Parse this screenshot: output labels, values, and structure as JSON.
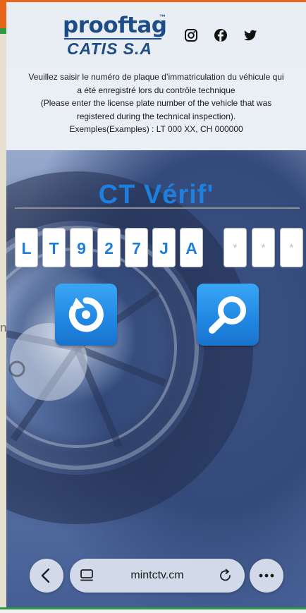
{
  "header": {
    "brand_name": "prooftag",
    "brand_tm": "™",
    "brand_sub": "CATIS S.A",
    "social": [
      "instagram-icon",
      "facebook-icon",
      "twitter-icon"
    ]
  },
  "instructions": {
    "lines": [
      "Veuillez saisir le numéro de plaque d’immatriculation du véhicule qui",
      "a été enregistré lors du contrôle technique",
      "(Please enter the license plate number of the vehicle that was",
      "registered during the technical inspection).",
      "Exemples(Examples) : LT 000 XX, CH 000000"
    ]
  },
  "hero": {
    "title": "CT Vérif'"
  },
  "plate": {
    "chars": [
      "L",
      "T",
      "9",
      "2",
      "7",
      "J",
      "A",
      "*",
      "*",
      "*"
    ]
  },
  "actions": {
    "reset_icon": "refresh-icon",
    "search_icon": "search-icon"
  },
  "browser": {
    "url": "mintctv.cm"
  },
  "underlying": {
    "stray_text": "n"
  },
  "colors": {
    "brand_blue": "#1d4c86",
    "accent_blue": "#1f7fde",
    "top_orange": "#e8661a",
    "bottom_green": "#2e9a44"
  }
}
